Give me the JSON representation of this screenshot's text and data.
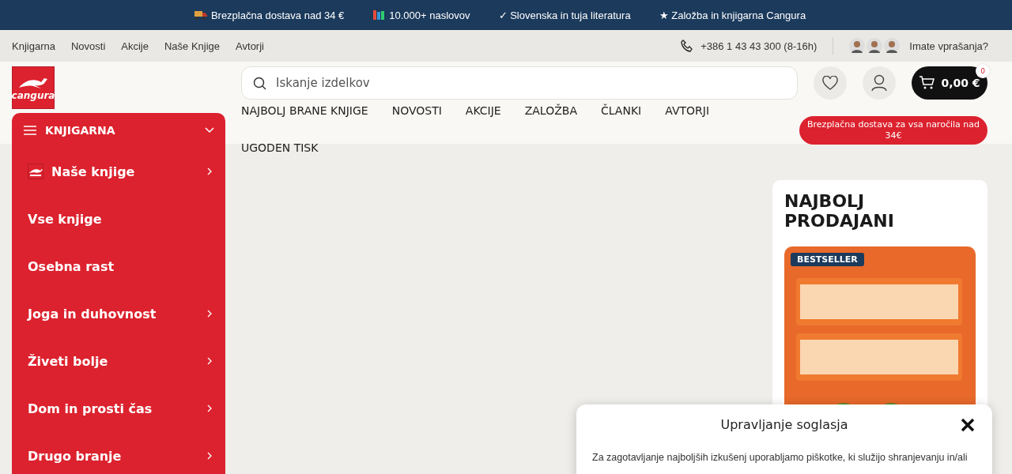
{
  "announcement_bar": {
    "items": [
      {
        "kind": "truck",
        "text": "Brezplačna dostava nad 34 €"
      },
      {
        "kind": "books",
        "text": "10.000+ naslovov"
      },
      {
        "kind": "text",
        "text": "✓ Slovenska in tuja literatura"
      },
      {
        "kind": "text",
        "text": "★ Založba in knjigarna Cangura"
      }
    ]
  },
  "top_nav": {
    "links": [
      "Knjigarna",
      "Novosti",
      "Akcije",
      "Naše Knjige",
      "Avtorji"
    ],
    "phone": "+386 1 43 43 300 (8-16h)",
    "help": "Imate vprašanja?"
  },
  "header": {
    "logo": "cangura",
    "search": {
      "placeholder": "Iskanje izdelkov"
    },
    "cart": {
      "total": "0,00 €",
      "count": "0"
    }
  },
  "main_menu": {
    "items": [
      "NAJBOLJ BRANE KNJIGE",
      "NOVOSTI",
      "AKCIJE",
      "ZALOŽBA",
      "ČLANKI",
      "AVTORJI",
      "UGODEN TISK"
    ],
    "promo": "Brezplačna dostava za vsa naročila nad 34€"
  },
  "sidebar": {
    "title": "KNJIGARNA",
    "items": [
      {
        "kind": "logo",
        "label": "Naše knjige",
        "has_submenu": true
      },
      {
        "kind": "plain",
        "label": "Vse knjige",
        "has_submenu": false
      },
      {
        "kind": "plain",
        "label": "Osebna rast",
        "has_submenu": false
      },
      {
        "kind": "plain",
        "label": "Joga in duhovnost",
        "has_submenu": true
      },
      {
        "kind": "plain",
        "label": "Živeti bolje",
        "has_submenu": true
      },
      {
        "kind": "plain",
        "label": "Dom in prosti čas",
        "has_submenu": true
      },
      {
        "kind": "plain",
        "label": "Drugo branje",
        "has_submenu": true
      }
    ]
  },
  "bestsellers": {
    "title": "NAJBOLJ PRODAJANI",
    "products": [
      {
        "kind": "picture",
        "badge": "BESTSELLER"
      }
    ]
  },
  "cookie_dialog": {
    "title": "Upravljanje soglasja",
    "text": "Za zagotavljanje najboljših izkušenj uporabljamo piškotke, ki služijo shranjevanju in/ali"
  }
}
